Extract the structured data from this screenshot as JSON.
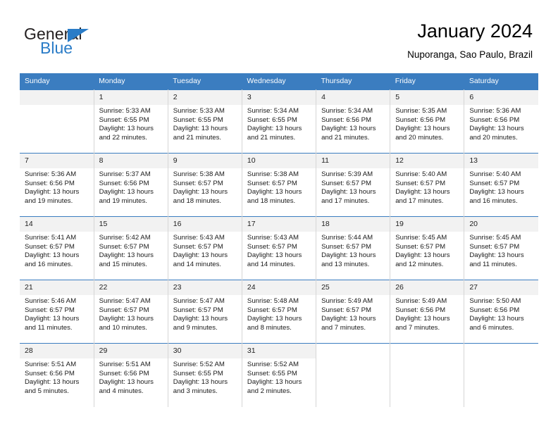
{
  "brand": {
    "word_one": "General",
    "word_two": "Blue",
    "triangle_icon": "triangle-icon",
    "accent_color": "#2a7cc7"
  },
  "header": {
    "title": "January 2024",
    "location": "Nuporanga, Sao Paulo, Brazil"
  },
  "theme": {
    "header_row_bg": "#3b7dc0",
    "daynum_bg": "#f2f2f2",
    "grid_line": "#3b7dc0",
    "cell_divider": "#d6d6d6"
  },
  "calendar": {
    "weekday_headers": [
      "Sunday",
      "Monday",
      "Tuesday",
      "Wednesday",
      "Thursday",
      "Friday",
      "Saturday"
    ],
    "weeks": [
      [
        {
          "day": "",
          "empty": true,
          "lines": []
        },
        {
          "day": "1",
          "lines": [
            "Sunrise: 5:33 AM",
            "Sunset: 6:55 PM",
            "Daylight: 13 hours",
            "and 22 minutes."
          ]
        },
        {
          "day": "2",
          "lines": [
            "Sunrise: 5:33 AM",
            "Sunset: 6:55 PM",
            "Daylight: 13 hours",
            "and 21 minutes."
          ]
        },
        {
          "day": "3",
          "lines": [
            "Sunrise: 5:34 AM",
            "Sunset: 6:55 PM",
            "Daylight: 13 hours",
            "and 21 minutes."
          ]
        },
        {
          "day": "4",
          "lines": [
            "Sunrise: 5:34 AM",
            "Sunset: 6:56 PM",
            "Daylight: 13 hours",
            "and 21 minutes."
          ]
        },
        {
          "day": "5",
          "lines": [
            "Sunrise: 5:35 AM",
            "Sunset: 6:56 PM",
            "Daylight: 13 hours",
            "and 20 minutes."
          ]
        },
        {
          "day": "6",
          "lines": [
            "Sunrise: 5:36 AM",
            "Sunset: 6:56 PM",
            "Daylight: 13 hours",
            "and 20 minutes."
          ]
        }
      ],
      [
        {
          "day": "7",
          "lines": [
            "Sunrise: 5:36 AM",
            "Sunset: 6:56 PM",
            "Daylight: 13 hours",
            "and 19 minutes."
          ]
        },
        {
          "day": "8",
          "lines": [
            "Sunrise: 5:37 AM",
            "Sunset: 6:56 PM",
            "Daylight: 13 hours",
            "and 19 minutes."
          ]
        },
        {
          "day": "9",
          "lines": [
            "Sunrise: 5:38 AM",
            "Sunset: 6:57 PM",
            "Daylight: 13 hours",
            "and 18 minutes."
          ]
        },
        {
          "day": "10",
          "lines": [
            "Sunrise: 5:38 AM",
            "Sunset: 6:57 PM",
            "Daylight: 13 hours",
            "and 18 minutes."
          ]
        },
        {
          "day": "11",
          "lines": [
            "Sunrise: 5:39 AM",
            "Sunset: 6:57 PM",
            "Daylight: 13 hours",
            "and 17 minutes."
          ]
        },
        {
          "day": "12",
          "lines": [
            "Sunrise: 5:40 AM",
            "Sunset: 6:57 PM",
            "Daylight: 13 hours",
            "and 17 minutes."
          ]
        },
        {
          "day": "13",
          "lines": [
            "Sunrise: 5:40 AM",
            "Sunset: 6:57 PM",
            "Daylight: 13 hours",
            "and 16 minutes."
          ]
        }
      ],
      [
        {
          "day": "14",
          "lines": [
            "Sunrise: 5:41 AM",
            "Sunset: 6:57 PM",
            "Daylight: 13 hours",
            "and 16 minutes."
          ]
        },
        {
          "day": "15",
          "lines": [
            "Sunrise: 5:42 AM",
            "Sunset: 6:57 PM",
            "Daylight: 13 hours",
            "and 15 minutes."
          ]
        },
        {
          "day": "16",
          "lines": [
            "Sunrise: 5:43 AM",
            "Sunset: 6:57 PM",
            "Daylight: 13 hours",
            "and 14 minutes."
          ]
        },
        {
          "day": "17",
          "lines": [
            "Sunrise: 5:43 AM",
            "Sunset: 6:57 PM",
            "Daylight: 13 hours",
            "and 14 minutes."
          ]
        },
        {
          "day": "18",
          "lines": [
            "Sunrise: 5:44 AM",
            "Sunset: 6:57 PM",
            "Daylight: 13 hours",
            "and 13 minutes."
          ]
        },
        {
          "day": "19",
          "lines": [
            "Sunrise: 5:45 AM",
            "Sunset: 6:57 PM",
            "Daylight: 13 hours",
            "and 12 minutes."
          ]
        },
        {
          "day": "20",
          "lines": [
            "Sunrise: 5:45 AM",
            "Sunset: 6:57 PM",
            "Daylight: 13 hours",
            "and 11 minutes."
          ]
        }
      ],
      [
        {
          "day": "21",
          "lines": [
            "Sunrise: 5:46 AM",
            "Sunset: 6:57 PM",
            "Daylight: 13 hours",
            "and 11 minutes."
          ]
        },
        {
          "day": "22",
          "lines": [
            "Sunrise: 5:47 AM",
            "Sunset: 6:57 PM",
            "Daylight: 13 hours",
            "and 10 minutes."
          ]
        },
        {
          "day": "23",
          "lines": [
            "Sunrise: 5:47 AM",
            "Sunset: 6:57 PM",
            "Daylight: 13 hours",
            "and 9 minutes."
          ]
        },
        {
          "day": "24",
          "lines": [
            "Sunrise: 5:48 AM",
            "Sunset: 6:57 PM",
            "Daylight: 13 hours",
            "and 8 minutes."
          ]
        },
        {
          "day": "25",
          "lines": [
            "Sunrise: 5:49 AM",
            "Sunset: 6:57 PM",
            "Daylight: 13 hours",
            "and 7 minutes."
          ]
        },
        {
          "day": "26",
          "lines": [
            "Sunrise: 5:49 AM",
            "Sunset: 6:56 PM",
            "Daylight: 13 hours",
            "and 7 minutes."
          ]
        },
        {
          "day": "27",
          "lines": [
            "Sunrise: 5:50 AM",
            "Sunset: 6:56 PM",
            "Daylight: 13 hours",
            "and 6 minutes."
          ]
        }
      ],
      [
        {
          "day": "28",
          "lines": [
            "Sunrise: 5:51 AM",
            "Sunset: 6:56 PM",
            "Daylight: 13 hours",
            "and 5 minutes."
          ]
        },
        {
          "day": "29",
          "lines": [
            "Sunrise: 5:51 AM",
            "Sunset: 6:56 PM",
            "Daylight: 13 hours",
            "and 4 minutes."
          ]
        },
        {
          "day": "30",
          "lines": [
            "Sunrise: 5:52 AM",
            "Sunset: 6:55 PM",
            "Daylight: 13 hours",
            "and 3 minutes."
          ]
        },
        {
          "day": "31",
          "lines": [
            "Sunrise: 5:52 AM",
            "Sunset: 6:55 PM",
            "Daylight: 13 hours",
            "and 2 minutes."
          ]
        },
        {
          "day": "",
          "blank": true,
          "lines": []
        },
        {
          "day": "",
          "blank": true,
          "lines": []
        },
        {
          "day": "",
          "blank": true,
          "lines": []
        }
      ]
    ]
  }
}
